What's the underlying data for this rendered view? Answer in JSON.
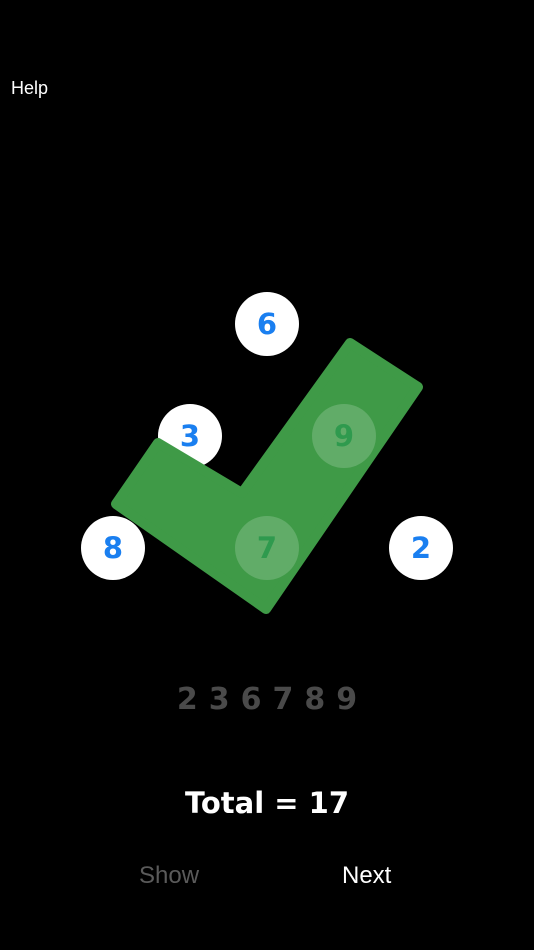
{
  "header": {
    "help_label": "Help"
  },
  "puzzle": {
    "circles": {
      "top": "6",
      "upper_left": "3",
      "upper_right": "9",
      "left": "8",
      "center": "7",
      "right": "2"
    },
    "result_icon": "checkmark-icon",
    "result_color": "#3f9a47"
  },
  "sequence": [
    "2",
    "3",
    "6",
    "7",
    "8",
    "9"
  ],
  "total_label": "Total = 17",
  "buttons": {
    "show_label": "Show",
    "next_label": "Next"
  },
  "colors": {
    "background": "#000000",
    "number_blue": "#1a7ff0",
    "checkmark_green": "#3f9a47",
    "sequence_gray": "#4a4a4a"
  }
}
